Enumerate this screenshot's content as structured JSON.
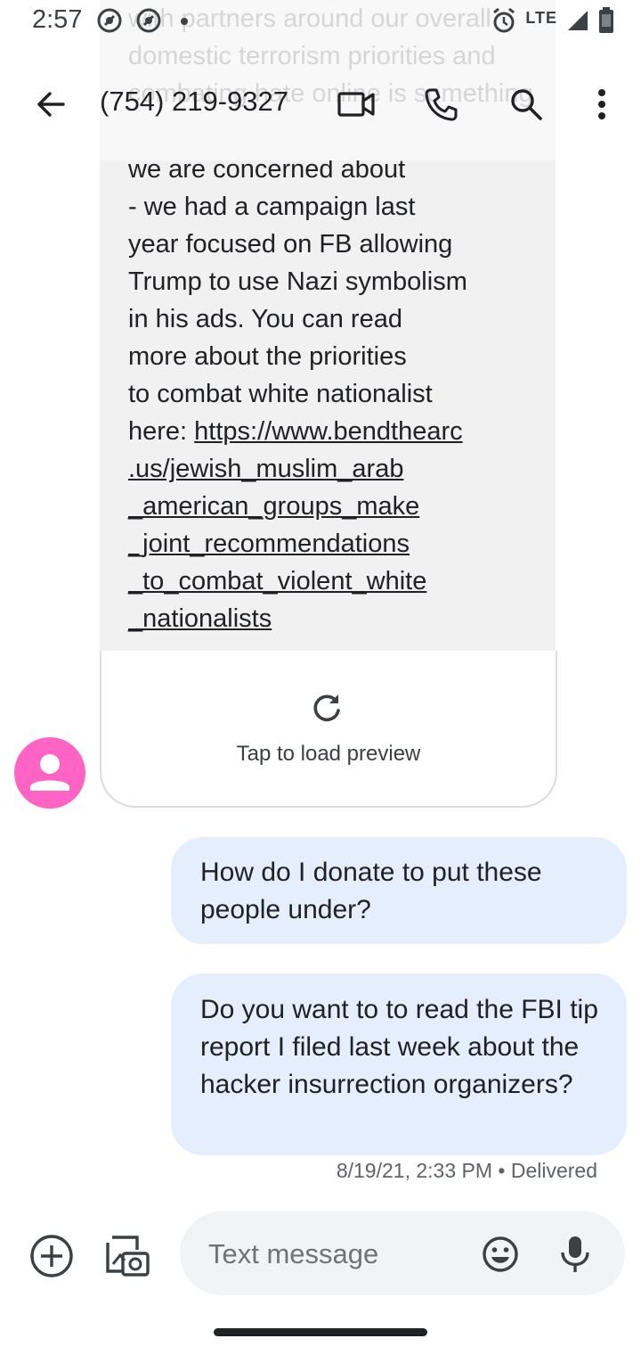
{
  "status_bar": {
    "time": "2:57",
    "network": "LTE"
  },
  "background_text": "with partners around our overall domestic terrorism priorities and combating hate online is something",
  "app_bar": {
    "contact": "(754) 219-9327"
  },
  "incoming_message": {
    "text": "we are concerned about\n- we had a campaign last\nyear focused on FB allowing\nTrump to use Nazi symbolism\nin his ads. You can read\nmore about the priorities\nto combat white nationalist\nhere: ",
    "link": "https://www.bendthearc\n.us/jewish_muslim_arab\n_american_groups_make\n_joint_recommendations\n_to_combat_violent_white\n_nationalists",
    "preview_label": "Tap to load preview"
  },
  "outgoing_messages": [
    {
      "text": "How do I donate to put these people under?"
    },
    {
      "text": "Do you want to to read the FBI tip report I filed last week about the hacker insurrection organizers?"
    }
  ],
  "message_meta": "8/19/21, 2:33 PM • Delivered",
  "compose": {
    "placeholder": "Text message"
  },
  "colors": {
    "avatar": "#ff63c3",
    "outgoing_bubble": "#e5eefc",
    "incoming_bubble": "#f1f1f1"
  }
}
